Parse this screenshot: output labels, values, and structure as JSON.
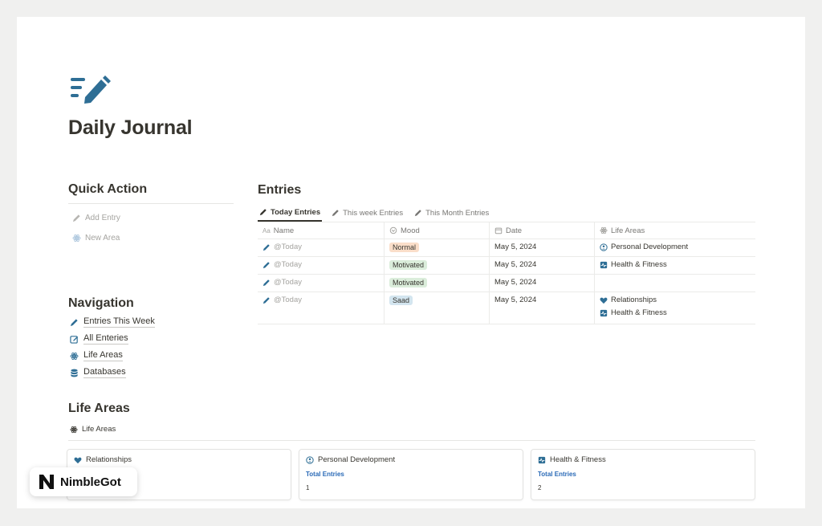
{
  "page": {
    "icon": "journal-pen-icon",
    "title": "Daily Journal"
  },
  "quick_action": {
    "heading": "Quick Action",
    "buttons": [
      {
        "label": "Add Entry",
        "icon": "pencil-icon"
      },
      {
        "label": "New Area",
        "icon": "atom-icon"
      }
    ]
  },
  "navigation": {
    "heading": "Navigation",
    "items": [
      {
        "label": "Entries This Week",
        "icon": "pencil-icon"
      },
      {
        "label": "All Enteries",
        "icon": "edit-square-icon"
      },
      {
        "label": "Life Areas",
        "icon": "atom-icon"
      },
      {
        "label": "Databases",
        "icon": "database-icon"
      }
    ]
  },
  "entries": {
    "heading": "Entries",
    "tabs": [
      {
        "label": "Today Entries",
        "active": true
      },
      {
        "label": "This week Entries",
        "active": false
      },
      {
        "label": "This Month Entries",
        "active": false
      }
    ],
    "columns": [
      "Name",
      "Mood",
      "Date",
      "Life Areas"
    ],
    "rows": [
      {
        "name": "@Today",
        "mood": "Normal",
        "mood_color": "#fadec9",
        "date": "May 5, 2024",
        "areas": [
          "Personal Development"
        ]
      },
      {
        "name": "@Today",
        "mood": "Motivated",
        "mood_color": "#dbeddb",
        "date": "May 5, 2024",
        "areas": [
          "Health & Fitness"
        ]
      },
      {
        "name": "@Today",
        "mood": "Motivated",
        "mood_color": "#dbeddb",
        "date": "May 5, 2024",
        "areas": []
      },
      {
        "name": "@Today",
        "mood": "Saad",
        "mood_color": "#d3e5ef",
        "date": "May 5, 2024",
        "areas": [
          "Relationships",
          "Health & Fitness"
        ]
      }
    ]
  },
  "life_areas": {
    "heading": "Life Areas",
    "link_label": "Life Areas",
    "cards": [
      {
        "title": "Relationships",
        "icon": "heart-shield-icon",
        "total_label": "",
        "total": ""
      },
      {
        "title": "Personal Development",
        "icon": "person-circle-icon",
        "total_label": "Total Entries",
        "total": "1"
      },
      {
        "title": "Health & Fitness",
        "icon": "heartbeat-icon",
        "total_label": "Total Entries",
        "total": "2"
      }
    ]
  },
  "brand": {
    "name": "NimbleGot"
  },
  "colors": {
    "accent": "#2e6e95",
    "link_blue": "#2a6ab7"
  }
}
